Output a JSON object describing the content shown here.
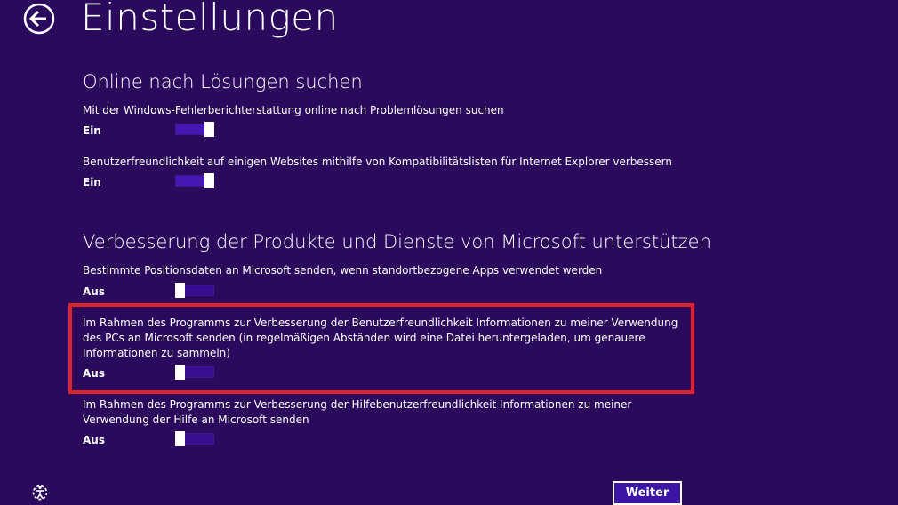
{
  "header": {
    "title": "Einstellungen",
    "back_icon": "back-arrow-icon"
  },
  "sections": [
    {
      "heading": "Online nach Lösungen suchen",
      "settings": [
        {
          "description": "Mit der Windows-Fehlerberichterstattung online nach Problemlösungen suchen",
          "state_label": "Ein",
          "enabled": true
        },
        {
          "description": "Benutzerfreundlichkeit auf einigen Websites mithilfe von Kompatibilitätslisten für Internet Explorer verbessern",
          "state_label": "Ein",
          "enabled": true
        }
      ]
    },
    {
      "heading": "Verbesserung der Produkte und Dienste von Microsoft unterstützen",
      "settings": [
        {
          "description": "Bestimmte Positionsdaten an Microsoft senden, wenn standortbezogene Apps verwendet werden",
          "state_label": "Aus",
          "enabled": false
        },
        {
          "description": "Im Rahmen des Programms zur Verbesserung der Benutzerfreundlichkeit Informationen zu meiner Verwendung des PCs an Microsoft senden (in regelmäßigen Abständen wird eine Datei heruntergeladen, um genauere Informationen zu sammeln)",
          "state_label": "Aus",
          "enabled": false,
          "highlighted": true
        },
        {
          "description": "Im Rahmen des Programms zur Verbesserung der Hilfebenutzerfreundlichkeit Informationen zu meiner Verwendung der Hilfe an Microsoft senden",
          "state_label": "Aus",
          "enabled": false
        }
      ]
    }
  ],
  "footer": {
    "ease_of_access_icon": "ease-of-access-icon",
    "next_label": "Weiter"
  },
  "colors": {
    "background": "#2b0a5e",
    "toggle_track": "#4617b4",
    "highlight": "#e0202a",
    "text": "#ffffff"
  }
}
